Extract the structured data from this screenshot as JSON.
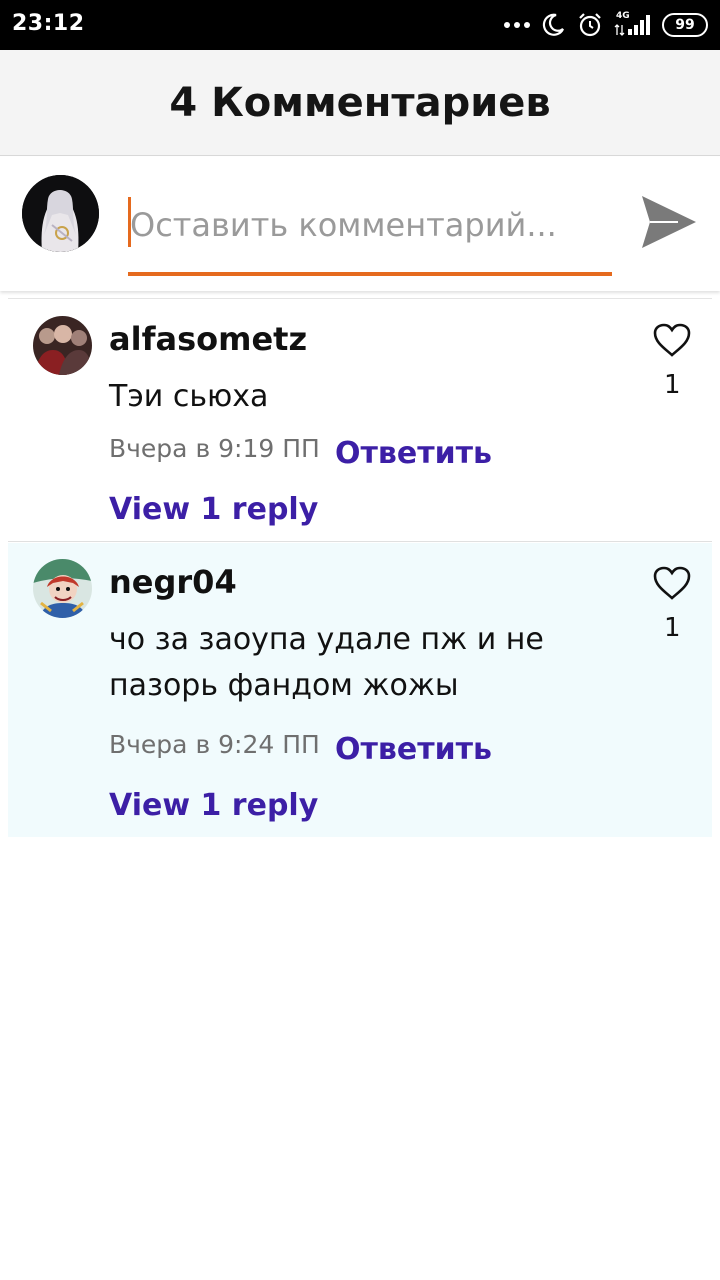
{
  "status_bar": {
    "time": "23:12",
    "network": "4G",
    "battery": "99"
  },
  "header": {
    "title": "4 Комментариев"
  },
  "compose": {
    "placeholder": "Оставить комментарий..."
  },
  "comments": [
    {
      "username": "alfasometz",
      "text": "Тэи сьюха",
      "time": "Вчера в 9:19 ПП",
      "reply_label": "Ответить",
      "view_replies": "View 1 reply",
      "likes": "1"
    },
    {
      "username": "negr04",
      "text_lines": [
        "чо за заоупа удале пж и не",
        "пазорь фандом жожы"
      ],
      "time": "Вчера в 9:24 ПП",
      "reply_label": "Ответить",
      "view_replies": "View 1 reply",
      "likes": "1"
    }
  ],
  "colors": {
    "accent": "#e56a1e",
    "link": "#3c1fa6",
    "highlight_bg": "#f1fbfd"
  },
  "icons": [
    "moon-icon",
    "alarm-icon",
    "signal-icon",
    "battery-icon",
    "send-icon",
    "heart-icon"
  ]
}
